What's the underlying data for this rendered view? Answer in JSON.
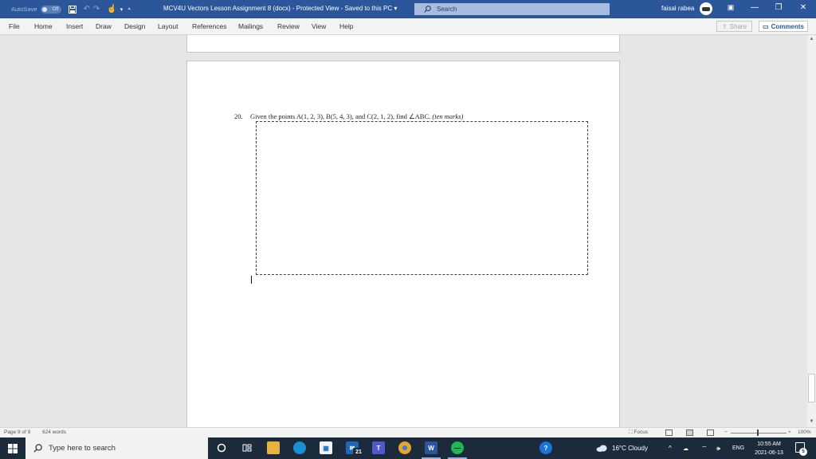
{
  "titlebar": {
    "autosave_label": "AutoSave",
    "autosave_state": "Off",
    "document_title": "MCV4U Vectors Lesson Assignment 8 (docx)  -  Protected View  -  Saved to this PC  ▾",
    "search_label": "Search",
    "user_name": "faisal rabea",
    "minimize": "—",
    "restore": "❐",
    "close": "✕",
    "ribbon_display": "▣"
  },
  "ribbon": {
    "tabs": [
      "File",
      "Home",
      "Insert",
      "Draw",
      "Design",
      "Layout",
      "References",
      "Mailings",
      "Review",
      "View",
      "Help"
    ],
    "share_label": "Share",
    "comments_label": "Comments"
  },
  "document": {
    "question_number": "20.",
    "question_text": "Given the points A(1, 2, 3), B(5, 4, 3), and C(2, 1, 2), find ∠ABC.",
    "question_marks": "(ten marks)"
  },
  "statusbar": {
    "page_info": "Page 9 of 9",
    "word_count": "624 words",
    "focus_label": "Focus",
    "zoom_minus": "−",
    "zoom_plus": "+",
    "zoom_level": "100%"
  },
  "taskbar": {
    "search_placeholder": "Type here to search",
    "mail_badge": "21",
    "weather": "16°C  Cloudy",
    "language": "ENG",
    "time": "10:55 AM",
    "date": "2021-06-13",
    "notification_count": "5"
  },
  "colors": {
    "word_blue": "#2b579a",
    "taskbar": "#1c2b3c"
  }
}
